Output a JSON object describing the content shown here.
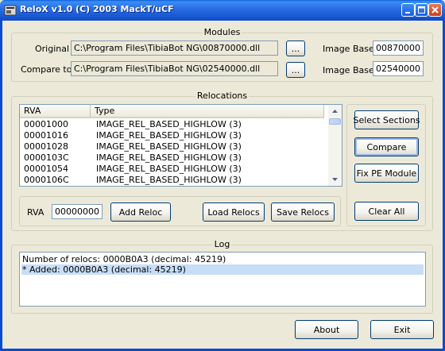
{
  "window": {
    "title": "ReloX v1.0 (C) 2003 MackT/uCF"
  },
  "modules": {
    "legend": "Modules",
    "original_label": "Original",
    "original_path": "C:\\Program Files\\TibiaBot NG\\00870000.dll",
    "original_browse": "...",
    "original_base_label": "Image Base",
    "original_base": "00870000",
    "compare_label": "Compare to",
    "compare_path": "C:\\Program Files\\TibiaBot NG\\02540000.dll",
    "compare_browse": "...",
    "compare_base_label": "Image Base",
    "compare_base": "02540000"
  },
  "relocations": {
    "legend": "Relocations",
    "columns": [
      "RVA",
      "Type"
    ],
    "rows": [
      {
        "rva": "00001000",
        "type": "IMAGE_REL_BASED_HIGHLOW (3)"
      },
      {
        "rva": "00001016",
        "type": "IMAGE_REL_BASED_HIGHLOW (3)"
      },
      {
        "rva": "00001028",
        "type": "IMAGE_REL_BASED_HIGHLOW (3)"
      },
      {
        "rva": "0000103C",
        "type": "IMAGE_REL_BASED_HIGHLOW (3)"
      },
      {
        "rva": "00001054",
        "type": "IMAGE_REL_BASED_HIGHLOW (3)"
      },
      {
        "rva": "0000106C",
        "type": "IMAGE_REL_BASED_HIGHLOW (3)"
      }
    ],
    "rva_label": "RVA",
    "rva_value": "00000000",
    "add_reloc": "Add Reloc",
    "load_relocs": "Load Relocs",
    "save_relocs": "Save Relocs"
  },
  "actions": {
    "select_sections": "Select Sections",
    "compare": "Compare",
    "fix_pe": "Fix PE Module",
    "clear_all": "Clear All"
  },
  "log": {
    "legend": "Log",
    "lines": [
      "Number of relocs: 0000B0A3 (decimal: 45219)",
      "* Added: 0000B0A3 (decimal: 45219)"
    ],
    "selected_index": 1
  },
  "footer": {
    "about": "About",
    "exit": "Exit"
  }
}
